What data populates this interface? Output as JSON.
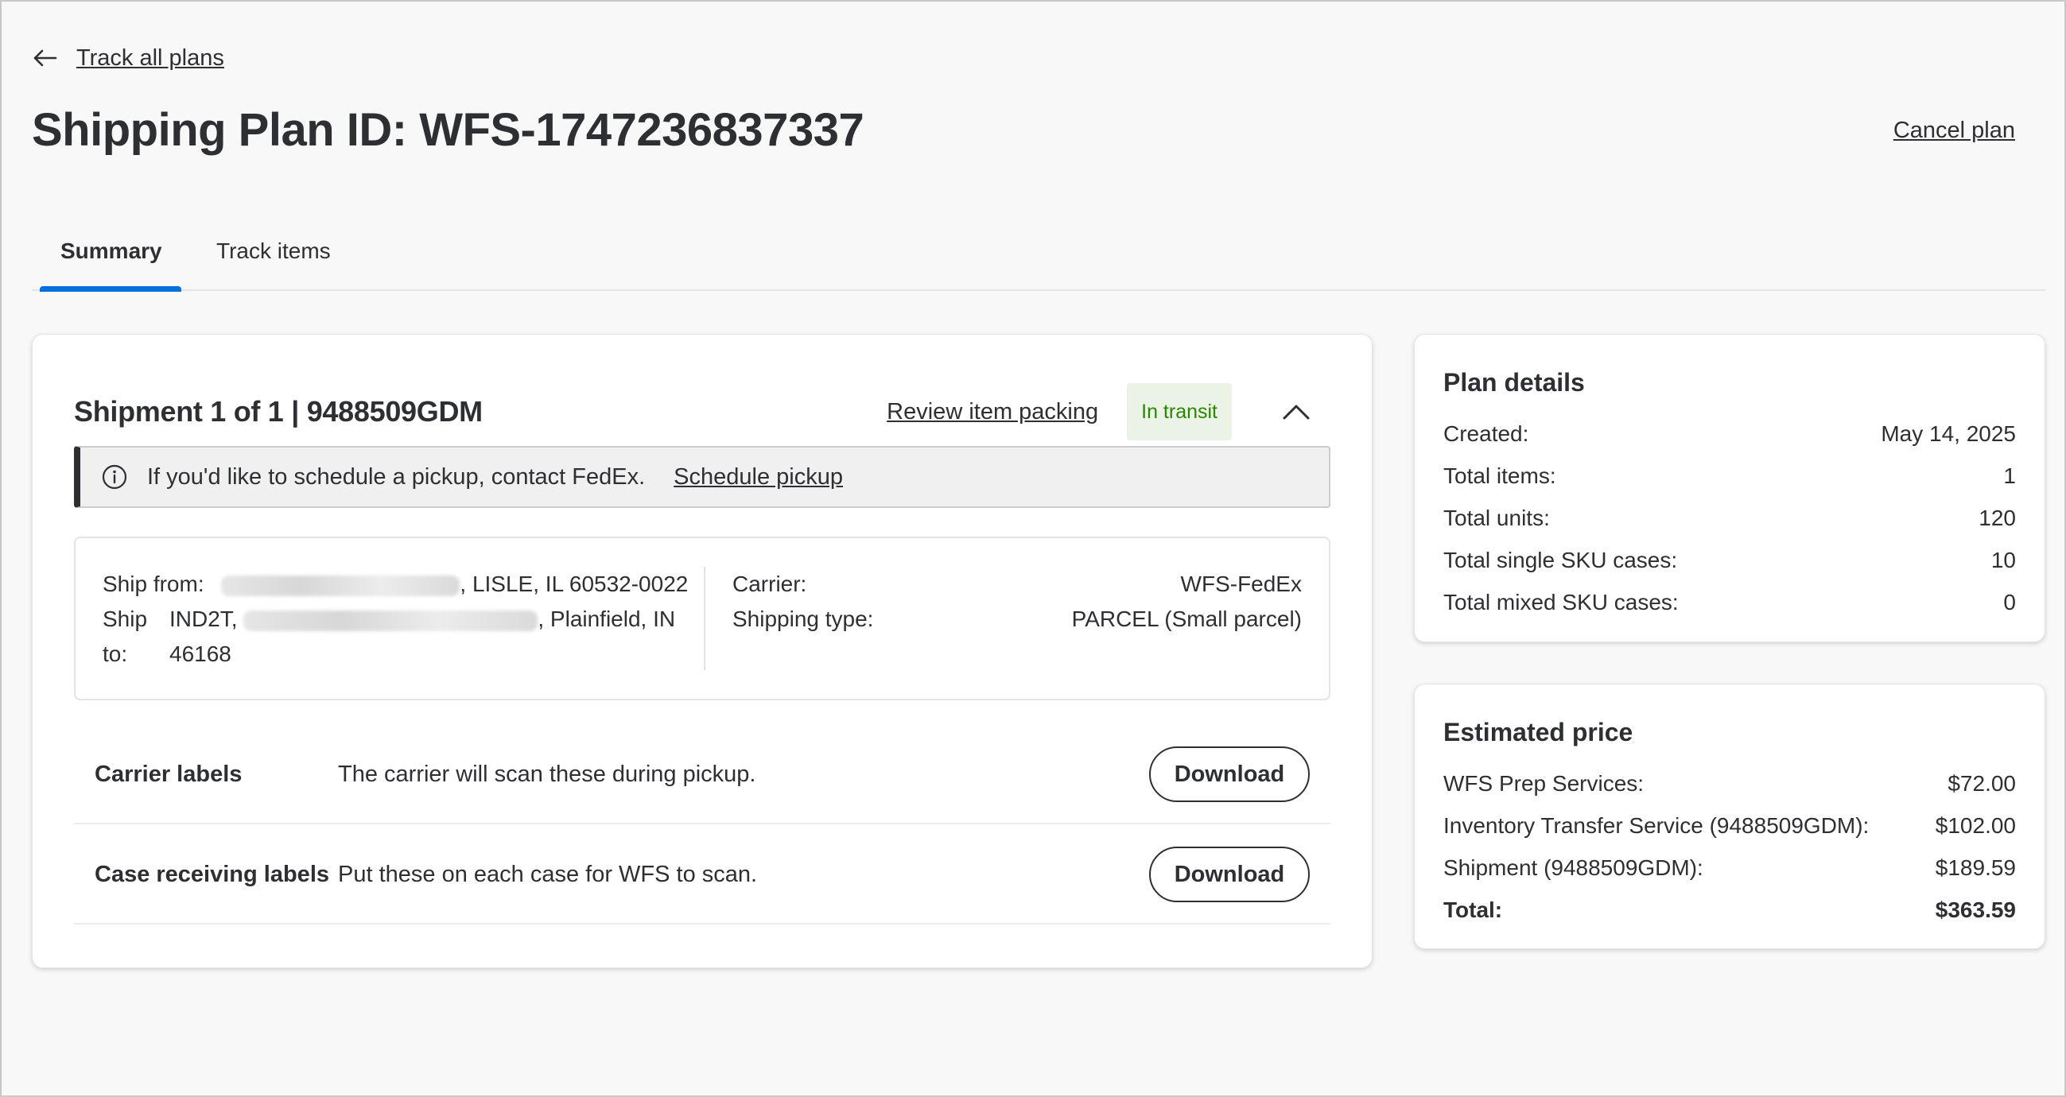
{
  "nav": {
    "back_label": "Track all plans"
  },
  "page": {
    "title": "Shipping Plan ID: WFS-1747236837337",
    "cancel_label": "Cancel plan"
  },
  "tabs": [
    {
      "label": "Summary",
      "active": true
    },
    {
      "label": "Track items",
      "active": false
    }
  ],
  "shipment": {
    "title": "Shipment 1 of 1 | 9488509GDM",
    "review_label": "Review item packing",
    "status": "In transit",
    "alert": {
      "text": "If you'd like to schedule a pickup, contact FedEx.",
      "link": "Schedule pickup"
    },
    "ship_from": {
      "label": "Ship from:",
      "value": ", LISLE, IL 60532-0022"
    },
    "ship_to": {
      "label_1": "Ship",
      "label_2": "to:",
      "prefix": "IND2T,",
      "value": ", Plainfield, IN",
      "zip": "46168"
    },
    "carrier": {
      "label": "Carrier:",
      "value": "WFS-FedEx"
    },
    "shipping_type": {
      "label": "Shipping type:",
      "value": "PARCEL (Small parcel)"
    },
    "labels": [
      {
        "name": "Carrier labels",
        "desc": "The carrier will scan these during pickup.",
        "button": "Download"
      },
      {
        "name": "Case receiving labels",
        "desc": "Put these on each case for WFS to scan.",
        "button": "Download"
      }
    ]
  },
  "plan_details": {
    "title": "Plan details",
    "rows": [
      {
        "label": "Created:",
        "value": "May 14, 2025"
      },
      {
        "label": "Total items:",
        "value": "1"
      },
      {
        "label": "Total units:",
        "value": "120"
      },
      {
        "label": "Total single SKU cases:",
        "value": "10"
      },
      {
        "label": "Total mixed SKU cases:",
        "value": "0"
      }
    ]
  },
  "estimated_price": {
    "title": "Estimated price",
    "rows": [
      {
        "label": "WFS Prep Services:",
        "value": "$72.00"
      },
      {
        "label": "Inventory Transfer Service (9488509GDM):",
        "value": "$102.00"
      },
      {
        "label": "Shipment (9488509GDM):",
        "value": "$189.59"
      },
      {
        "label": "Total:",
        "value": "$363.59"
      }
    ]
  },
  "colors": {
    "accent": "#0071dc",
    "status_bg": "#eaf3e6",
    "status_text": "#2a8703"
  }
}
